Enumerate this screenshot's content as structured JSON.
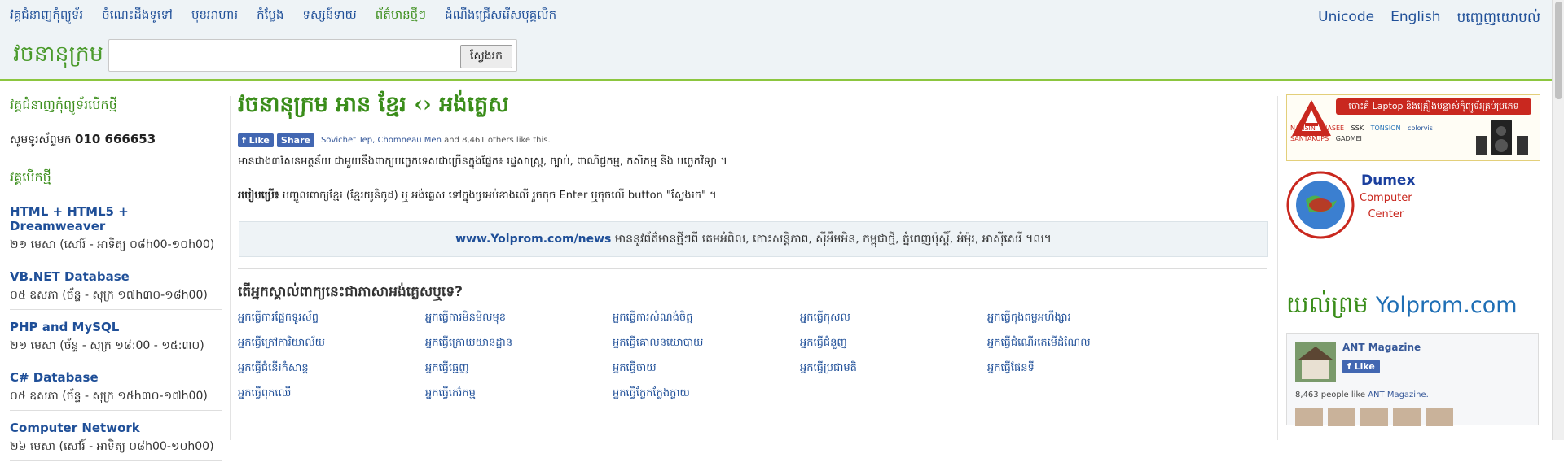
{
  "topnav": [
    {
      "label": "វគ្គជំនាញកុំព្យូទ័រ",
      "active": false
    },
    {
      "label": "ចំណេះដឹងទូទៅ",
      "active": false
    },
    {
      "label": "មុខអាហារ",
      "active": false
    },
    {
      "label": "កំប្លែង",
      "active": false
    },
    {
      "label": "ទស្សន៍ទាយ",
      "active": false
    },
    {
      "label": "ព័ត៌មានថ្មីៗ",
      "active": true
    },
    {
      "label": "ដំណឹងជ្រើសរើសបុគ្គលិក",
      "active": false
    }
  ],
  "rightnav": {
    "unicode": "Unicode",
    "english": "English",
    "ads": "បញ្ចេញយោបល់"
  },
  "search": {
    "logo": "វចនានុក្រម",
    "button": "ស្វែងរក",
    "value": ""
  },
  "sidebar": {
    "heading": "វគ្គជំនាញកុំព្យូទ័របើកថ្មី",
    "phone_label": "សូមទូរស័ព្ទមក",
    "phone_number": "010 666653",
    "open_heading": "វគ្គបើកថ្មី",
    "courses": [
      {
        "title": "HTML + HTML5 + Dreamweaver",
        "date": "២១ មេសា (សៅរ៍ - អាទិត្យ ០៨h00-១០h00)"
      },
      {
        "title": "VB.NET Database",
        "date": "០៥ ឧសភា (ច័ន្ទ - សុក្រ ១៧h៣០-១៨h00)"
      },
      {
        "title": "PHP and MySQL",
        "date": "២១ មេសា (ច័ន្ទ - សុក្រ ១៨:00 - ១៥:៣០)"
      },
      {
        "title": "C# Database",
        "date": "០៥ ឧសភា (ច័ន្ទ - សុក្រ ១៥h៣០-១៧h00)"
      },
      {
        "title": "Computer Network",
        "date": "២៦ មេសា (សៅរ៍ - អាទិត្យ ០៨h00-១០h00)"
      }
    ]
  },
  "main": {
    "title": "វចនានុក្រម អាន ខ្មែរ ‹› អង់គ្លេស",
    "fb_like": "Like",
    "fb_share": "Share",
    "fb_names": "Sovichet Tep, Chomneau Men",
    "fb_others": "and 8,461 others like this.",
    "description": "មានជាង៣សែនអត្ថន័យ ជាមួយនឹងពាក្យបច្ចេកទេសជាច្រើនក្នុងផ្នែក៖ រដ្ឋសាស្ត្រ, ច្បាប់, ពាណិជ្ជកម្ម, កសិកម្ម និង បច្ចេកវិទ្យា ។",
    "howto_label": "របៀបប្រើ៖",
    "howto_text": "បញ្ចូលពាក្យខ្មែរ (ខ្មែរយូនិកូដ) ឬ អង់គ្លេស ទៅក្នុងប្រអប់ខាងលើ រួចចុច Enter ឬចុចលើ button \"ស្វែងរក\" ។",
    "news_url": "www.Yolprom.com/news",
    "news_text": "មាននូវព័ត៌មានថ្មីៗពី តេមអំពិល, កោះសន្តិភាព, ស៊ីអឹមអិន, កម្ពុជាថ្មី, ភ្នំពេញប៉ុស្តិ៍, អំម៉ុរ, អាស៊ីសេរី ។ល។",
    "question": "តើអ្នកស្គាល់ពាក្យនេះជាភាសាអង់គ្លេសឬទេ?",
    "terms": [
      "អ្នកធ្វើការផ្នែកទូរស័ព្ទ",
      "អ្នកធ្វើការមិនមិលមុខ",
      "អ្នកធ្វើការសំណង់ចិត្ត",
      "អ្នកធ្វើកុសល",
      "អ្នកធ្វើកុងតម្លអហឹង្សារ",
      "អ្នកធ្វើក្រៅការិយាល័យ",
      "អ្នកធ្វើក្រោយយានដ្ឋាន",
      "អ្នកធ្វើគោលនយោបាយ",
      "អ្នកធ្វើជំនួញ",
      "អ្នកធ្វើជំណើរតេមើដំណែល",
      "អ្នកធ្វើជំនើរកំសាន្ត",
      "អ្នកធ្វើធ្មេញ",
      "អ្នកធ្វើចាយ",
      "អ្នកធ្វើប្រជាមតិ",
      "អ្នកធ្វើផែនទី",
      "អ្នកធ្វើពុកឈើ",
      "អ្នកធ្វើកេរ៌កម្ម",
      "អ្នកធ្វើក្លែកក្លែងក្លាយ"
    ]
  },
  "ads": {
    "banner_text": "ចោះគំ Laptop និងគ្រឿងបន្លាស់កុំព្យូទ័រគ្រប់ប្រភេទ",
    "brands": [
      "NANSIN",
      "HASEE",
      "SSK",
      "TONSION",
      "colorvis",
      "SANTAKUPS",
      "GADMEI"
    ],
    "dumex_name": "Dumex",
    "dumex_sub1": "Computer",
    "dumex_sub2": "Center",
    "yulprom_kh": "យល់ព្រម",
    "yulprom_en": "Yolprom.com",
    "fb_page_name": "ANT Magazine",
    "fb_page_like": "Like",
    "fb_page_count": "8,463 people like",
    "fb_page_count_name": "ANT Magazine."
  },
  "colors": {
    "accent_green": "#3a8d1a",
    "link_blue": "#1f4f98",
    "fb_blue": "#4267b2",
    "header_bg": "#eef3f6"
  }
}
